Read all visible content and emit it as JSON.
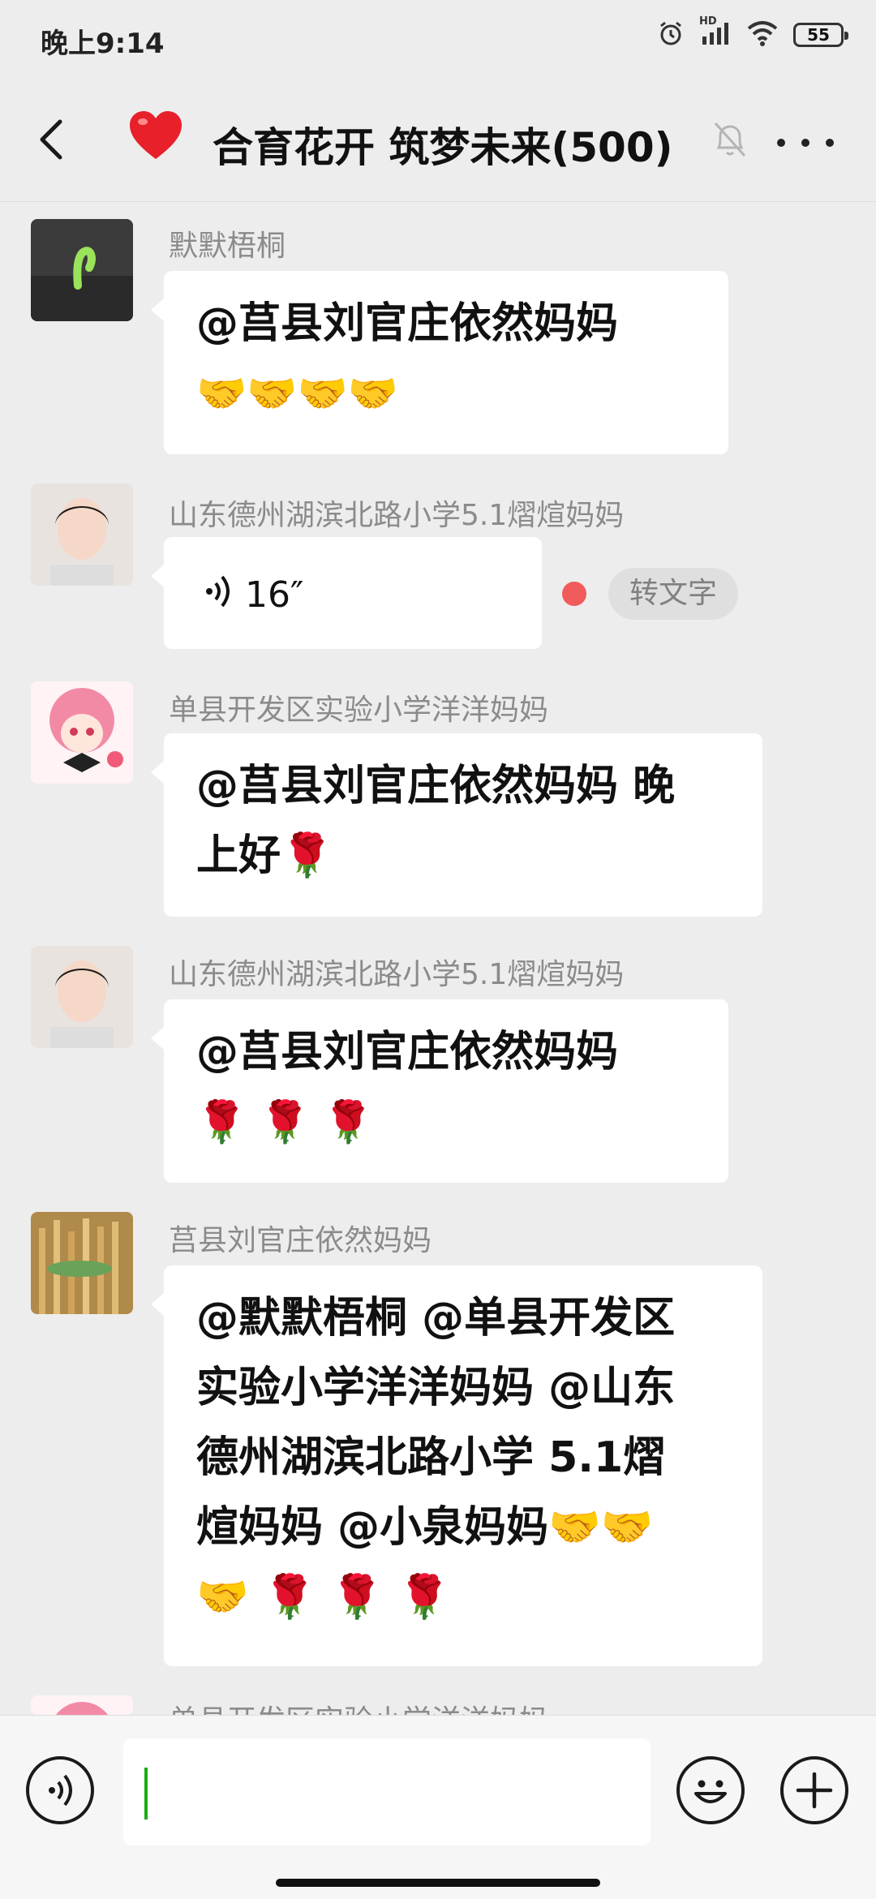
{
  "status_bar": {
    "time": "晚上9:14",
    "network_label": "HD",
    "battery": "55",
    "icons": [
      "alarm-icon",
      "signal-icon",
      "wifi-icon",
      "battery-icon"
    ]
  },
  "header": {
    "title": "合育花开 筑梦未来(500)",
    "heart_emoji": "❤️",
    "icons": [
      "back-icon",
      "mute-icon",
      "more-icon"
    ]
  },
  "messages": [
    {
      "sender": "默默梧桐",
      "lines": [
        "@莒县刘官庄依然妈妈",
        "🤝🤝🤝🤝"
      ]
    },
    {
      "sender": "山东德州湖滨北路小学5.1熠煊妈妈",
      "voice_duration": "16″",
      "to_text_label": "转文字"
    },
    {
      "sender": "单县开发区实验小学洋洋妈妈",
      "lines": [
        "@莒县刘官庄依然妈妈  晚",
        "上好🌹"
      ]
    },
    {
      "sender": "山东德州湖滨北路小学5.1熠煊妈妈",
      "lines": [
        "@莒县刘官庄依然妈妈",
        "🌹 🌹 🌹"
      ]
    },
    {
      "sender": "莒县刘官庄依然妈妈",
      "lines": [
        "@默默梧桐 @单县开发区",
        "实验小学洋洋妈妈 @山东",
        "德州湖滨北路小学 5.1熠",
        "煊妈妈 @小泉妈妈🤝🤝",
        "🤝 🌹 🌹 🌹"
      ]
    },
    {
      "sender": "单县开发区实验小学洋洋妈妈"
    }
  ],
  "input_bar": {
    "input_value": "",
    "icons": [
      "voice-input-icon",
      "emoji-icon",
      "plus-icon"
    ]
  }
}
